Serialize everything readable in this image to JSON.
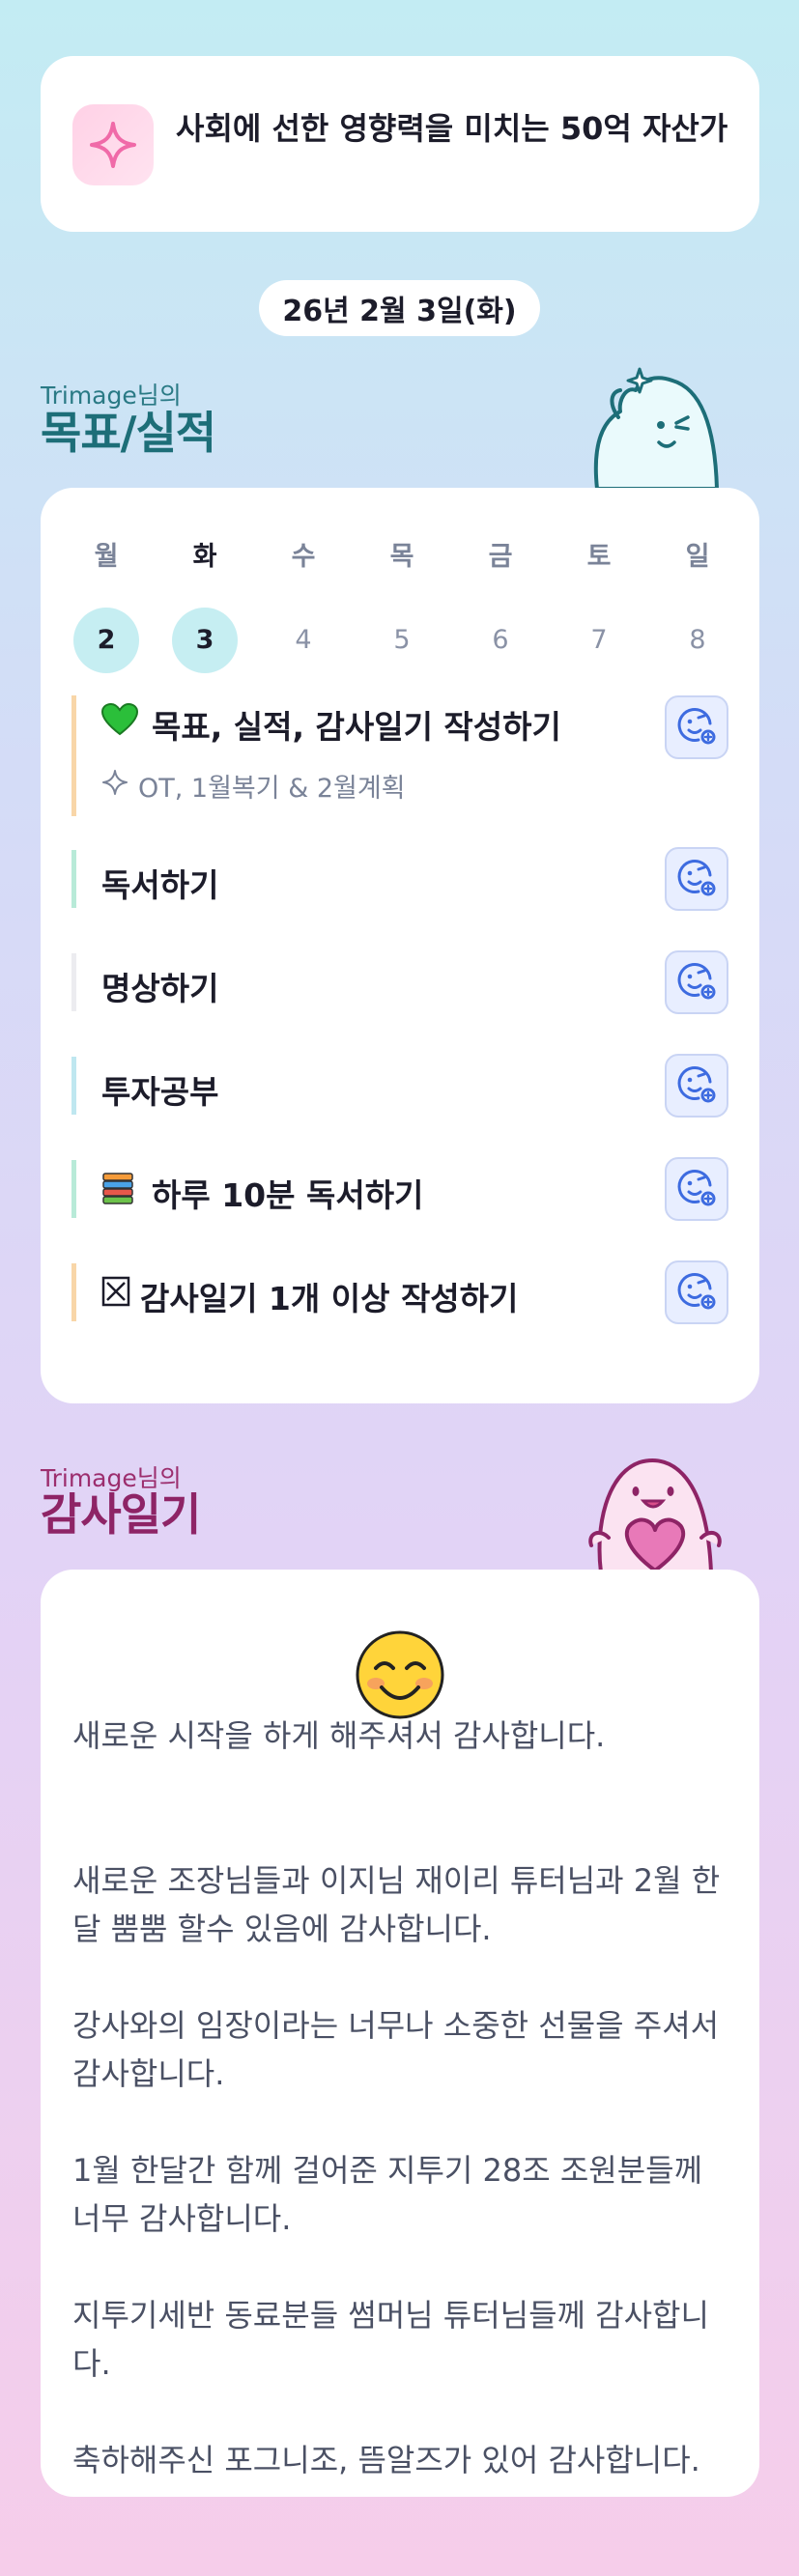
{
  "goal": {
    "title": "사회에 선한 영향력을 미치는 50억 자산가",
    "icon": "sparkle-icon"
  },
  "date": "26년 2월 3일(화)",
  "goals_section": {
    "user_label": "Trimage님의",
    "heading": "목표/실적"
  },
  "week": [
    {
      "day": "월",
      "num": "2",
      "done": true,
      "today": false
    },
    {
      "day": "화",
      "num": "3",
      "done": true,
      "today": true
    },
    {
      "day": "수",
      "num": "4",
      "done": false,
      "today": false
    },
    {
      "day": "목",
      "num": "5",
      "done": false,
      "today": false
    },
    {
      "day": "금",
      "num": "6",
      "done": false,
      "today": false
    },
    {
      "day": "토",
      "num": "7",
      "done": false,
      "today": false
    },
    {
      "day": "일",
      "num": "8",
      "done": false,
      "today": false
    }
  ],
  "tasks": [
    {
      "label": "목표, 실적, 감사일기 작성하기",
      "icon": "green-heart-icon",
      "sub": "OT, 1월복기 & 2월계획",
      "sub_icon": "sparkle-outline-icon",
      "bar_color": "#f8d6a8"
    },
    {
      "label": "독서하기",
      "bar_color": "#b8ead8"
    },
    {
      "label": "명상하기",
      "bar_color": "#ececf0"
    },
    {
      "label": "투자공부",
      "bar_color": "#bfe7f0"
    },
    {
      "label": "하루 10분 독서하기",
      "icon": "books-icon",
      "bar_color": "#b8ead8"
    },
    {
      "label": "감사일기 1개 이상 작성하기",
      "icon": "ballot-box-x-icon",
      "bar_color": "#f8d6a8"
    }
  ],
  "thanks_section": {
    "user_label": "Trimage님의",
    "heading": "감사일기"
  },
  "thanks": {
    "emoji": "smiling-face-icon",
    "entries": [
      "새로운 시작을 하게 해주셔서 감사합니다.",
      "새로운 조장님들과 이지님 재이리 튜터님과 2월 한달 뿜뿜 할수 있음에 감사합니다.",
      "강사와의 임장이라는 너무나 소중한 선물을 주셔서 감사합니다.",
      "1월 한달간 함께 걸어준 지투기 28조 조원분들께 너무 감사합니다.",
      "지투기세반 동료분들 썸머님 튜터님들께 감사합니다.",
      "축하해주신 포그니조, 뜸알즈가 있어 감사합니다."
    ]
  },
  "colors": {
    "accent_teal": "#1d6e78",
    "accent_magenta": "#8e2466",
    "done_day": "#c6eef2",
    "emoji_button": "#e8eeff"
  }
}
